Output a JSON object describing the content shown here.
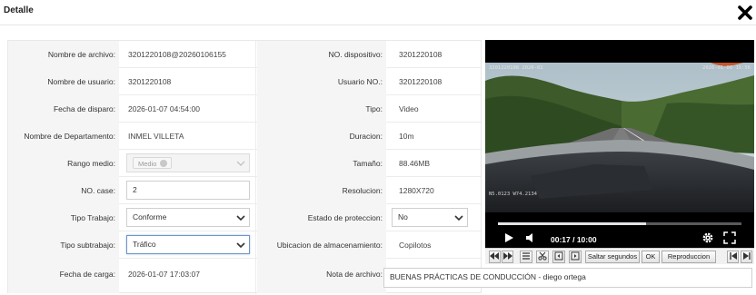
{
  "dialog": {
    "title": "Detalle"
  },
  "fields": {
    "nombre_archivo": {
      "label": "Nombre de archivo:",
      "value": "3201220108@20260106155"
    },
    "no_dispositivo": {
      "label": "NO. dispositivo:",
      "value": "3201220108"
    },
    "nombre_usuario": {
      "label": "Nombre de usuario:",
      "value": "3201220108"
    },
    "usuario_no": {
      "label": "Usuario NO.:",
      "value": "3201220108"
    },
    "fecha_disparo": {
      "label": "Fecha de disparo:",
      "value": "2026-01-07 04:54:00"
    },
    "tipo": {
      "label": "Tipo:",
      "value": "Video"
    },
    "departamento": {
      "label": "Nombre de Departamento:",
      "value": "INMEL VILLETA"
    },
    "duracion": {
      "label": "Duracion:",
      "value": "10m"
    },
    "rango_medio": {
      "label": "Rango medio:",
      "tag": "Medio"
    },
    "tamano": {
      "label": "Tamaño:",
      "value": "88.46MB"
    },
    "no_case": {
      "label": "NO. case:",
      "value": "2"
    },
    "resolucion": {
      "label": "Resolucion:",
      "value": "1280X720"
    },
    "tipo_trabajo": {
      "label": "Tipo Trabajo:",
      "value": "Conforme"
    },
    "estado_proteccion": {
      "label": "Estado de proteccion:",
      "value": "No"
    },
    "tipo_subtrabajo": {
      "label": "Tipo subtrabajo:",
      "value": "Tráfico"
    },
    "ubicacion": {
      "label": "Ubicacion de almacenamiento:",
      "value": "Copilotos"
    },
    "fecha_carga": {
      "label": "Fecha de carga:",
      "value": "2026-01-07 17:03:07"
    },
    "nota_archivo": {
      "label": "Nota de archivo:",
      "value": "BUENAS PRÁCTICAS DE CONDUCCIÓN - diego ortega"
    }
  },
  "player": {
    "time": "00:17 / 10:00",
    "progress_fraction": 0.61,
    "osd_top_left": "3201220108 2026-01",
    "osd_top_right": "2026-01-06 15:56",
    "osd_bottom_left": "N5.0123 W74.2134",
    "toolbar": {
      "skip_label": "Saltar segundos",
      "ok_label": "OK",
      "playback_label": "Reproduccion"
    }
  },
  "colors": {
    "focus_border": "#6f95c8",
    "video_bg": "#000000"
  }
}
